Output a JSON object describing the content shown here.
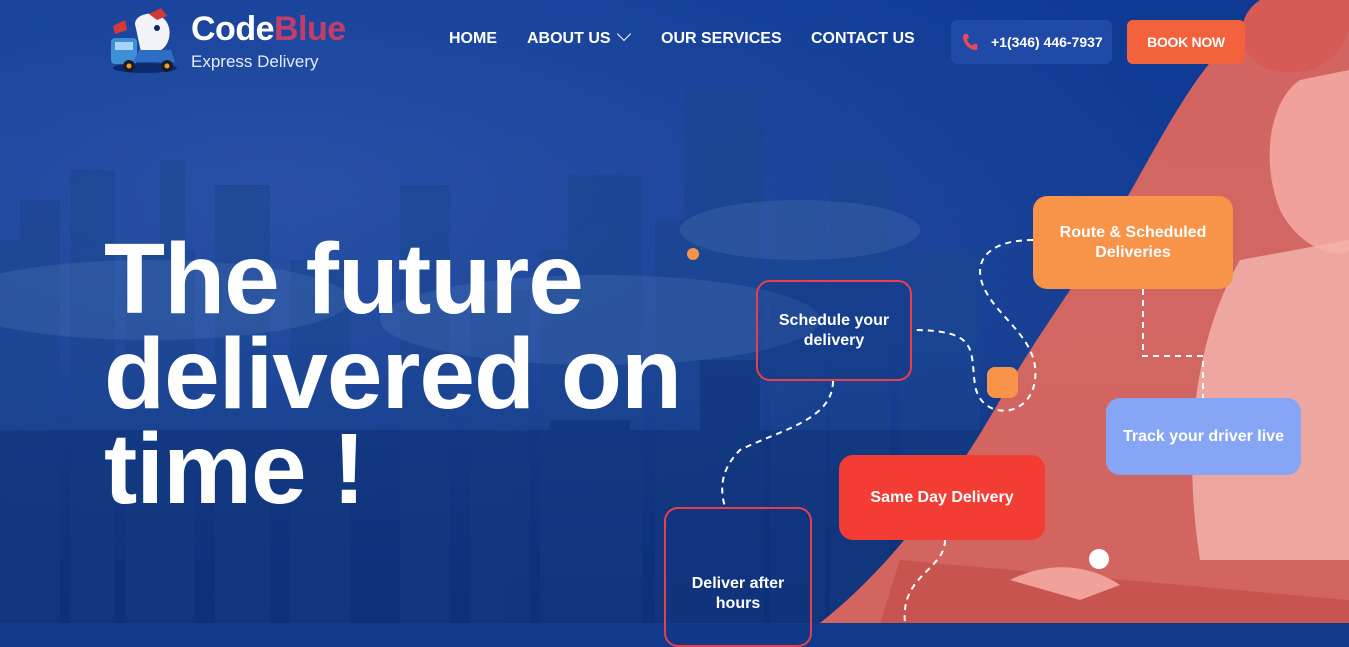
{
  "brand": {
    "name_part1": "Code",
    "name_part2": "Blue",
    "tagline": "Express Delivery",
    "accent_color": "#c13e6a"
  },
  "nav": {
    "items": [
      {
        "label": "HOME"
      },
      {
        "label": "ABOUT US",
        "has_dropdown": true
      },
      {
        "label": "OUR SERVICES"
      },
      {
        "label": "CONTACT US"
      }
    ]
  },
  "header_actions": {
    "phone_label": "+1(346) 446-7937",
    "phone_icon": "phone-icon",
    "book_label": "BOOK NOW",
    "book_color": "#f4613d"
  },
  "hero": {
    "headline_lines": [
      "The future",
      "delivered on",
      "time !"
    ]
  },
  "feature_cards": {
    "route": "Route & Scheduled Deliveries",
    "schedule": "Schedule your delivery",
    "track": "Track your driver live",
    "same_day": "Same Day Delivery",
    "after_hours": "Deliver after hours"
  }
}
